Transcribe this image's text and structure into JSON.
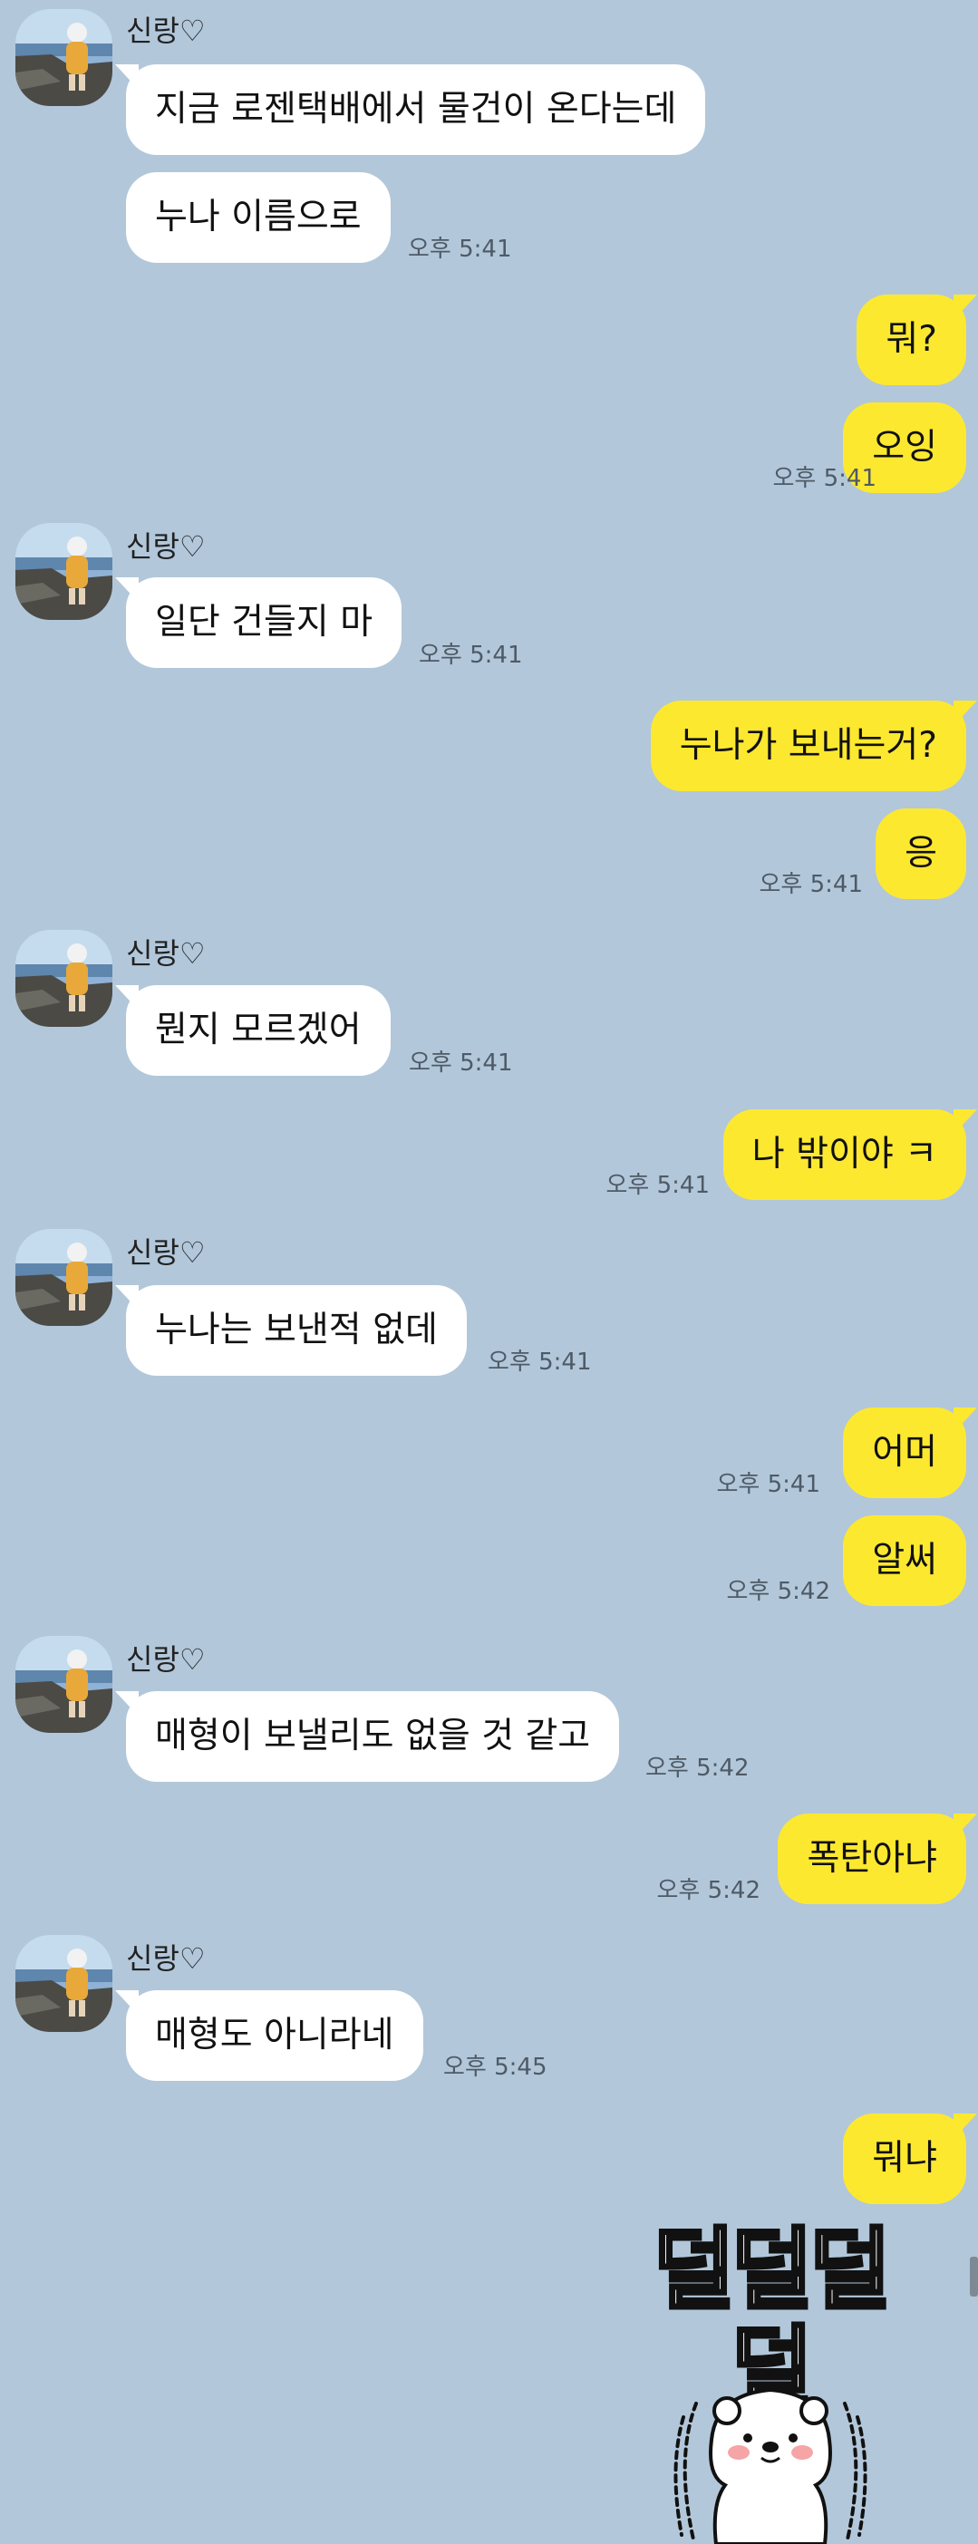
{
  "sender_name": "신랑♡",
  "messages": [
    {
      "text": "지금 로젠택배에서 물건이 온다는데"
    },
    {
      "text": "누나 이름으로",
      "time": "오후 5:41"
    },
    {
      "text": "뭐?"
    },
    {
      "text": "오잉",
      "time": "오후 5:41"
    },
    {
      "text": "일단 건들지 마",
      "time": "오후 5:41"
    },
    {
      "text": "누나가 보내는거?"
    },
    {
      "text": "응",
      "time": "오후 5:41"
    },
    {
      "text": "뭔지 모르겠어",
      "time": "오후 5:41"
    },
    {
      "text": "나 밖이야 ㅋ",
      "time": "오후 5:41"
    },
    {
      "text": "누나는 보낸적 없데",
      "time": "오후 5:41"
    },
    {
      "text": "어머",
      "time": "오후 5:41"
    },
    {
      "text": "알써",
      "time": "오후 5:42"
    },
    {
      "text": "매형이 보낼리도 없을 것 같고",
      "time": "오후 5:42"
    },
    {
      "text": "폭탄아냐",
      "time": "오후 5:42"
    },
    {
      "text": "매형도 아니라네",
      "time": "오후 5:45"
    },
    {
      "text": "뭐냐"
    }
  ],
  "sticker_text": "덜덜덜덜",
  "colors": {
    "background": "#b2c7da",
    "incoming_bubble": "#ffffff",
    "outgoing_bubble": "#fde830"
  }
}
